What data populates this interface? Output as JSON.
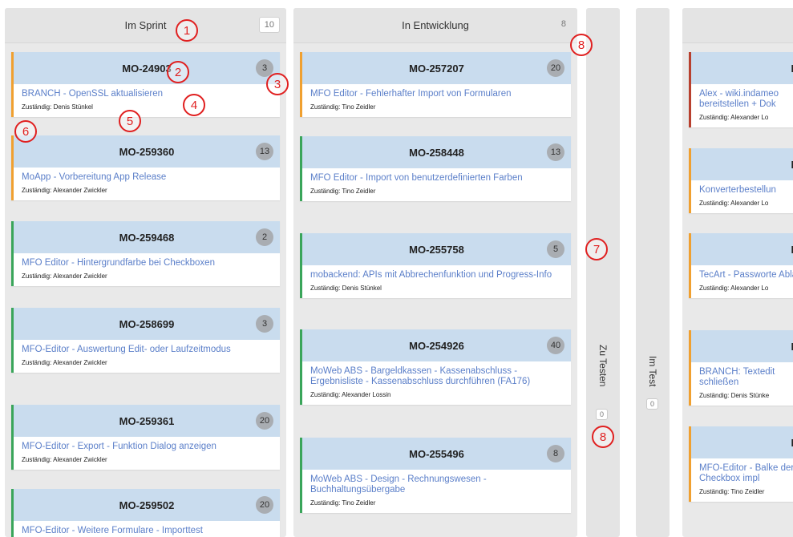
{
  "columns": {
    "sprint": {
      "title": "Im Sprint",
      "count": "10",
      "cards": [
        {
          "id": "MO-24903",
          "points": "3",
          "title": "BRANCH - OpenSSL aktualisieren",
          "assignee": "Zuständig: Denis Stünkel"
        },
        {
          "id": "MO-259360",
          "points": "13",
          "title": "MoApp - Vorbereitung App Release",
          "assignee": "Zuständig: Alexander Zwickler"
        },
        {
          "id": "MO-259468",
          "points": "2",
          "title": "MFO Editor - Hintergrundfarbe bei Checkboxen",
          "assignee": "Zuständig: Alexander Zwickler"
        },
        {
          "id": "MO-258699",
          "points": "3",
          "title": "MFO-Editor - Auswertung Edit- oder Laufzeitmodus",
          "assignee": "Zuständig: Alexander Zwickler"
        },
        {
          "id": "MO-259361",
          "points": "20",
          "title": "MFO-Editor - Export - Funktion Dialog anzeigen",
          "assignee": "Zuständig: Alexander Zwickler"
        },
        {
          "id": "MO-259502",
          "points": "20",
          "title": "MFO-Editor - Weitere Formulare - Importtest",
          "assignee": ""
        }
      ]
    },
    "development": {
      "title": "In Entwicklung",
      "count": "8",
      "cards": [
        {
          "id": "MO-257207",
          "points": "20",
          "title": "MFO Editor - Fehlerhafter Import von Formularen",
          "assignee": "Zuständig: Tino Zeidler"
        },
        {
          "id": "MO-258448",
          "points": "13",
          "title": "MFO Editor - Import von benutzerdefinierten Farben",
          "assignee": "Zuständig: Tino Zeidler"
        },
        {
          "id": "MO-255758",
          "points": "5",
          "title": "mobackend: APIs mit Abbrechenfunktion und Progress-Info",
          "assignee": "Zuständig: Denis Stünkel"
        },
        {
          "id": "MO-254926",
          "points": "40",
          "title": "MoWeb ABS - Bargeldkassen - Kassenabschluss - Ergebnisliste - Kassenabschluss durchführen (FA176)",
          "assignee": "Zuständig: Alexander Lossin"
        },
        {
          "id": "MO-255496",
          "points": "8",
          "title": "MoWeb ABS - Design - Rechnungswesen - Buchhaltungsübergabe",
          "assignee": "Zuständig: Tino Zeidler"
        }
      ]
    },
    "to_test": {
      "title": "Zu Testen",
      "count": "0"
    },
    "in_test": {
      "title": "Im Test",
      "count": "0"
    },
    "right": {
      "cards": [
        {
          "id": "MO",
          "title": "Alex - wiki.indameo bereitstellen + Dok",
          "assignee": "Zuständig: Alexander Lo"
        },
        {
          "id": "MO",
          "title": "Konverterbestellun",
          "assignee": "Zuständig: Alexander Lo"
        },
        {
          "id": "MO",
          "title": "TecArt - Passworte Ablauf",
          "assignee": "Zuständig: Alexander Lo"
        },
        {
          "id": "MO",
          "title": "BRANCH: Textedit schließen",
          "assignee": "Zuständig: Denis Stünke"
        },
        {
          "id": "MO",
          "title": "MFO-Editor - Balke der Checkbox impl",
          "assignee": "Zuständig: Tino Zeidler"
        }
      ]
    }
  },
  "markers": [
    "1",
    "2",
    "3",
    "4",
    "5",
    "6",
    "7",
    "8",
    "8"
  ],
  "colors": {
    "header_blue": "#c9dcee",
    "link_blue": "#5b7fc9",
    "orange_border": "#f0a030",
    "green_border": "#3aa55a",
    "red_border": "#b8402e",
    "marker_red": "#e02020"
  }
}
